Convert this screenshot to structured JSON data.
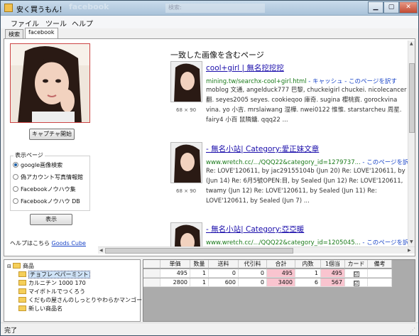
{
  "window": {
    "title": "安く買うもん！",
    "background_tab": "facebook",
    "background_search": "検索: "
  },
  "menu": [
    "ファイル",
    "ツール",
    "ヘルプ"
  ],
  "tabs": [
    "検索",
    "facebook"
  ],
  "left": {
    "capture_button": "キャプチャ開始",
    "display_group_title": "表示ページ",
    "options": [
      "google画像検索",
      "偽アカウント写真情報館",
      "Facebookノウハウ集",
      "Facebookノウハウ DB"
    ],
    "selected_option": 0,
    "show_button": "表示",
    "help_prefix": "ヘルプはこちら",
    "help_link": "Goods Cube"
  },
  "results": {
    "heading": "一致した画像を含むページ",
    "items": [
      {
        "size": "68 × 90",
        "title": "cool+girl | 無名挖挖挖",
        "url": "mining.tw/searchx-cool+girl.html",
        "cache": " - キャッシュ - このページを訳す",
        "snippet": "moblog 文通, angelduck777 巴黎, chuckeigirl chuckei. nicolecancer 翻. seyes2005 seyes. cookieqoo 庫奇. sugina 櫻桃賓. gorockvina vina. yo 小吉. mrslaiwang 湿樺. nwei0122 惟惟. starstarcheu 周星. fairy4 小百 鼠隣鏞. qqq22 ..."
      },
      {
        "size": "68 × 90",
        "title": "- 無名小站| Category:愛正妹文章",
        "url": "www.wretch.cc/.../QQQ22&category_id=1279737...",
        "cache": " - このページを訳",
        "snippet": "Re: LOVE'120611, by jac29155104b (Jun 20) Re: LOVE'120611, by (Jun 14) Re: 6月5號OPEN:目, by Sealed (Jun 12) Re: LOVE'120611, twamy (Jun 12) Re: LOVE'120611, by Sealed (Jun 11) Re: LOVE'120611, by Sealed (Jun 7) ..."
      },
      {
        "size": "",
        "title": "- 無名小站| Category:亞亞暖",
        "url": "www.wretch.cc/.../QQQ22&category_id=1205045...",
        "cache": " - このページを訳",
        "snippet": ""
      }
    ]
  },
  "tree": {
    "root": "商品",
    "items": [
      "チョフレ ペパーミント",
      "カルニチン 1000 170",
      "マイボトルでつくろう",
      "くだもの屋さんのしっとりやわらかマンゴー",
      "新しい商品名"
    ],
    "selected": 0
  },
  "grid": {
    "columns": [
      "単価",
      "数量",
      "送料",
      "代引料",
      "合計",
      "内数",
      "1個当",
      "カード",
      "備考"
    ],
    "rows": [
      [
        "495",
        "1",
        "0",
        "0",
        "495",
        "1",
        "495",
        "☑",
        ""
      ],
      [
        "2800",
        "1",
        "600",
        "0",
        "3400",
        "6",
        "567",
        "☑",
        ""
      ]
    ]
  },
  "status": "完了"
}
